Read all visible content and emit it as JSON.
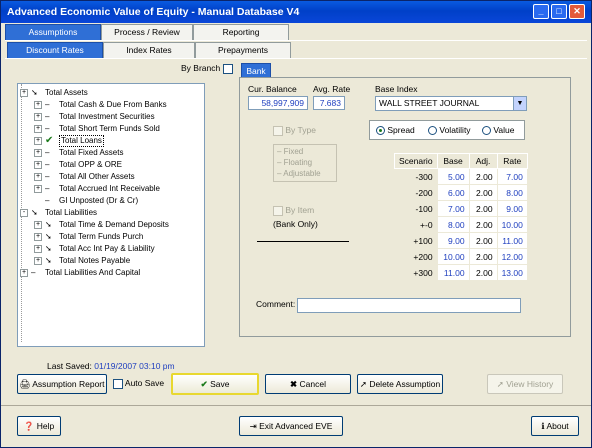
{
  "window": {
    "title": "Advanced Economic Value of Equity - Manual Database V4"
  },
  "top_tabs": [
    {
      "label": "Assumptions"
    },
    {
      "label": "Process / Review"
    },
    {
      "label": "Reporting"
    }
  ],
  "sub_tabs": [
    {
      "label": "Discount Rates"
    },
    {
      "label": "Index Rates"
    },
    {
      "label": "Prepayments"
    }
  ],
  "by_branch_label": "By Branch",
  "bank_tab_label": "Bank",
  "tree": [
    {
      "label": "Total Assets",
      "expander": "+"
    },
    {
      "label": "Total Cash & Due From Banks",
      "expander": "+"
    },
    {
      "label": "Total Investment Securities",
      "expander": "+"
    },
    {
      "label": "Total Short Term Funds Sold",
      "expander": "+"
    },
    {
      "label": "Total Loans",
      "expander": "+"
    },
    {
      "label": "Total Fixed Assets",
      "expander": "+"
    },
    {
      "label": "Total OPP & ORE",
      "expander": "+"
    },
    {
      "label": "Total All Other Assets",
      "expander": "+"
    },
    {
      "label": "Total Accrued Int Receivable",
      "expander": "+"
    },
    {
      "label": "GI Unposted (Dr & Cr)",
      "expander": ""
    },
    {
      "label": "Total Liabilities",
      "expander": "-"
    },
    {
      "label": "Total Time & Demand Deposits",
      "expander": "+"
    },
    {
      "label": "Total  Term Funds Purch",
      "expander": "+"
    },
    {
      "label": "Total Acc Int Pay & Liability",
      "expander": "+"
    },
    {
      "label": "Total Notes Payable",
      "expander": "+"
    },
    {
      "label": "Total Liabilities And Capital",
      "expander": "+"
    }
  ],
  "cur_balance": {
    "label": "Cur. Balance",
    "value": "58,997,909"
  },
  "avg_rate": {
    "label": "Avg. Rate",
    "value": "7.683"
  },
  "base_index": {
    "label": "Base Index",
    "value": "WALL STREET JOURNAL"
  },
  "by_type": {
    "label": "By Type",
    "options": [
      "Fixed",
      "Floating",
      "Adjustable"
    ]
  },
  "by_item": {
    "label": "By Item",
    "sub": "(Bank Only)"
  },
  "mode": {
    "options": [
      "Spread",
      "Volatility",
      "Value"
    ],
    "selected": "Spread"
  },
  "scenario_table": {
    "headers": [
      "Scenario",
      "Base",
      "Adj.",
      "Rate"
    ],
    "rows": [
      [
        "-300",
        "5.00",
        "2.00",
        "7.00"
      ],
      [
        "-200",
        "6.00",
        "2.00",
        "8.00"
      ],
      [
        "-100",
        "7.00",
        "2.00",
        "9.00"
      ],
      [
        "+-0",
        "8.00",
        "2.00",
        "10.00"
      ],
      [
        "+100",
        "9.00",
        "2.00",
        "11.00"
      ],
      [
        "+200",
        "10.00",
        "2.00",
        "12.00"
      ],
      [
        "+300",
        "11.00",
        "2.00",
        "13.00"
      ]
    ]
  },
  "comment": {
    "label": "Comment:",
    "value": ""
  },
  "last_saved": {
    "label": "Last Saved:",
    "value": "01/19/2007 03:10 pm"
  },
  "buttons": {
    "assumption_report": "Assumption Report",
    "auto_save": "Auto Save",
    "save": "Save",
    "cancel": "Cancel",
    "delete_assumption": "Delete Assumption",
    "view_history": "View History",
    "help": "Help",
    "exit": "Exit Advanced EVE",
    "about": "About"
  },
  "colors": {
    "title_bar": "#0040c8",
    "active_tab": "#2f6fd6",
    "value_text": "#1f3fbf",
    "check_green": "#1b7a1b"
  }
}
